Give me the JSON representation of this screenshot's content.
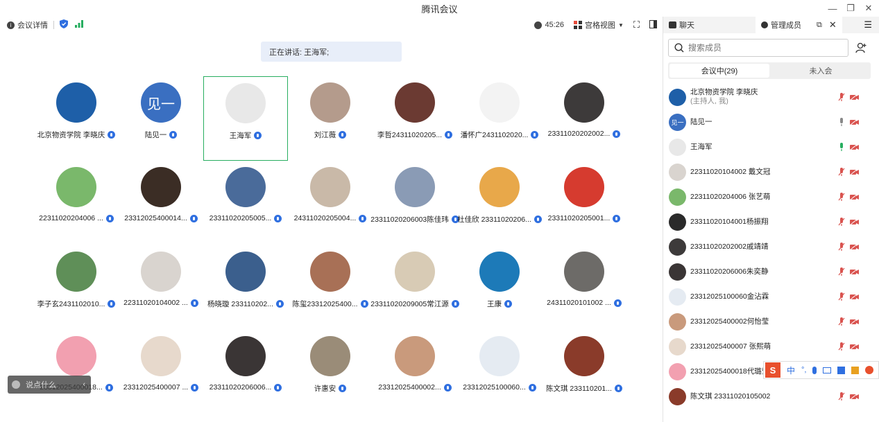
{
  "window": {
    "title": "腾讯会议"
  },
  "toolbar": {
    "meeting_details": "会议详情",
    "timer": "45:26",
    "grid_view": "宫格视图"
  },
  "speaking": {
    "text": "正在讲话: 王海军;"
  },
  "tiles": [
    {
      "name": "北京物资学院 李晓庆",
      "color": "#1e5fa8"
    },
    {
      "name": "陆见一",
      "color": "#3a6fc1",
      "initials": "见一"
    },
    {
      "name": "王海军",
      "color": "#e8e8e8",
      "active": true
    },
    {
      "name": "刘江薇",
      "color": "#b49b8c"
    },
    {
      "name": "李哲24311020205...",
      "color": "#6b3a32"
    },
    {
      "name": "潘怀广2431102020...",
      "color": "#f3f3f3"
    },
    {
      "name": "23311020202002...",
      "color": "#3d3a3a"
    },
    {
      "name": "22311020204006 ...",
      "color": "#7ab86b"
    },
    {
      "name": "23312025400014...",
      "color": "#3b2d25"
    },
    {
      "name": "23311020205005...",
      "color": "#4a6b9a"
    },
    {
      "name": "24311020205004...",
      "color": "#c9b9a8"
    },
    {
      "name": "23311020206003陈佳玮",
      "color": "#8a9bb5"
    },
    {
      "name": "杜佳欣 23311020206...",
      "color": "#e8a84a"
    },
    {
      "name": "23311020205001...",
      "color": "#d63b2f"
    },
    {
      "name": "李子玄2431102010...",
      "color": "#5f8f58"
    },
    {
      "name": "22311020104002 ...",
      "color": "#d9d4cf"
    },
    {
      "name": "杨晓璇 233110202...",
      "color": "#3b5f8d"
    },
    {
      "name": "陈玺23312025400...",
      "color": "#a87056"
    },
    {
      "name": "23311020209005常江源",
      "color": "#d8cbb5"
    },
    {
      "name": "王康",
      "color": "#1d7ab8"
    },
    {
      "name": "24311020101002 ...",
      "color": "#6d6b68"
    },
    {
      "name": "23312025400018...",
      "color": "#f2a0b0"
    },
    {
      "name": "23312025400007 ...",
      "color": "#e7d9cc"
    },
    {
      "name": "23311020206006...",
      "color": "#3a3535"
    },
    {
      "name": "许惠安",
      "color": "#9a8c78"
    },
    {
      "name": "23312025400002...",
      "color": "#c99a7c"
    },
    {
      "name": "23312025100060...",
      "color": "#e5ebf2"
    },
    {
      "name": "陈文琪 233110201...",
      "color": "#8a3b2a"
    }
  ],
  "chat_hint": {
    "text": "说点什么"
  },
  "panel": {
    "tab_chat": "聊天",
    "tab_members": "管理成员",
    "search_placeholder": "搜索成员",
    "seg_in_meeting": "会议中(29)",
    "seg_not_joined": "未入会"
  },
  "members": [
    {
      "name": "北京物资学院 李晓庆",
      "sub": "(主持人, 我)",
      "color": "#1e5fa8",
      "mic": "muted"
    },
    {
      "name": "陆见一",
      "color": "#3a6fc1",
      "initials": "见一",
      "mic": "off"
    },
    {
      "name": "王海军",
      "color": "#e8e8e8",
      "mic": "on"
    },
    {
      "name": "22311020104002 戴文冠",
      "color": "#d9d4cf",
      "mic": "muted"
    },
    {
      "name": "22311020204006 张艺萌",
      "color": "#7ab86b",
      "mic": "muted"
    },
    {
      "name": "23311020104001杨振翔",
      "color": "#2a2a2a",
      "mic": "muted"
    },
    {
      "name": "23311020202002戚靖靖",
      "color": "#3d3a3a",
      "mic": "muted"
    },
    {
      "name": "23311020206006朱奕静",
      "color": "#3a3535",
      "mic": "muted"
    },
    {
      "name": "23312025100060金沾霖",
      "color": "#e5ebf2",
      "mic": "muted"
    },
    {
      "name": "23312025400002何怡莹",
      "color": "#c99a7c",
      "mic": "muted"
    },
    {
      "name": "23312025400007 张熙萌",
      "color": "#e7d9cc",
      "mic": "muted"
    },
    {
      "name": "23312025400018代璐莹",
      "color": "#f2a0b0",
      "mic": "muted"
    },
    {
      "name": "陈文琪 23311020105002",
      "color": "#8a3b2a",
      "mic": "muted"
    }
  ],
  "ime": {
    "label": "中"
  }
}
